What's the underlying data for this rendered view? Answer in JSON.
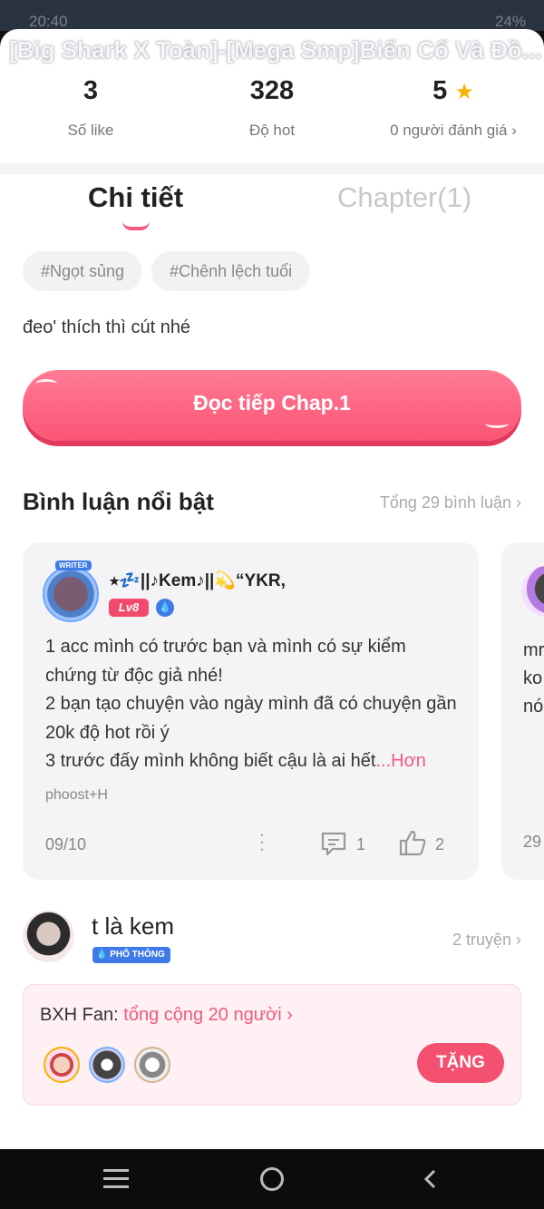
{
  "status_bar": {
    "time": "20:40",
    "battery": "24%"
  },
  "story": {
    "title": "[Big Shark X Toàn]-[Mega Smp]Biến Cố Và Đồ..."
  },
  "stats": {
    "likes": {
      "value": "3",
      "label": "Số like"
    },
    "hot": {
      "value": "328",
      "label": "Độ hot"
    },
    "rating": {
      "value": "5",
      "label": "0 người đánh giá ›"
    }
  },
  "tabs": {
    "detail": "Chi tiết",
    "chapter": "Chapter(1)"
  },
  "tags": [
    "#Ngọt sủng",
    "#Chênh lệch tuổi"
  ],
  "description": "đeo' thích thì cút nhé",
  "read_button": "Đọc tiếp Chap.1",
  "comments_section": {
    "title": "Bình luận nổi bật",
    "total": "Tổng 29 bình luận  ›",
    "comment": {
      "avatar_tag": "WRITER",
      "username": "⭑💤||♪Kem♪||💫“YKR,",
      "level": "Lv8",
      "body": "1 acc mình có trước bạn và mình có sự kiểm chứng từ độc giả nhé!\n2 bạn tạo chuyện vào ngày mình đã có chuyện gần 20k độ hot rồi ý\n3 trước đấy mình không biết cậu là ai hết",
      "more": "...Hơn",
      "signature": "phoost+H",
      "date": "09/10",
      "replies": "1",
      "likes": "2"
    },
    "next_comment_peek": {
      "lines": "mr\nko\nnó",
      "date": "29"
    }
  },
  "author": {
    "name": "t là kem",
    "badge": "PHỔ THÔNG",
    "story_count": "2 truyện  ›"
  },
  "fans": {
    "label": "BXH Fan:",
    "total": "tổng cộng 20 người ›",
    "gift_button": "TẶNG"
  }
}
